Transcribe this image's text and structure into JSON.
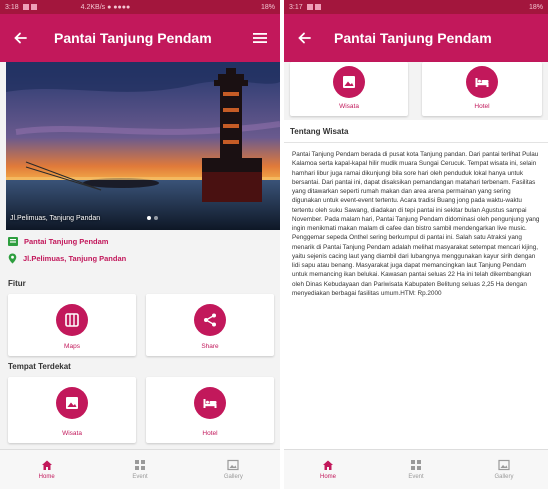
{
  "colors": {
    "primary": "#c2185b",
    "status_bar": "#a3163d",
    "background": "#f3f3f3",
    "inactive": "#9a9a9a"
  },
  "screen_left": {
    "status_bar": {
      "left_text": "3:18",
      "center_text": "4.2KB/s ● ●●●●",
      "right_text": "18%"
    },
    "app_bar": {
      "title": "Pantai Tanjung Pendam",
      "back_icon": "arrow-left-icon",
      "menu_icon": "hamburger-menu-icon"
    },
    "hero": {
      "caption": "Jl.Pelimuas, Tanjung Pandan",
      "slides": 2,
      "active_slide": 1
    },
    "info": {
      "name": "Pantai Tanjung Pendam",
      "address": "Jl.Pelimuas, Tanjung Pandan",
      "name_icon": "place-card-icon",
      "address_icon": "map-pin-icon"
    },
    "fitur": {
      "title": "Fitur",
      "items": [
        {
          "label": "Maps",
          "icon": "map-icon"
        },
        {
          "label": "Share",
          "icon": "share-icon"
        }
      ]
    },
    "nearby": {
      "title": "Tempat Terdekat",
      "items": [
        {
          "label": "Wisata",
          "icon": "image-icon"
        },
        {
          "label": "Hotel",
          "icon": "bed-icon"
        }
      ]
    },
    "bottom_nav": [
      {
        "label": "Home",
        "icon": "home-icon",
        "active": true
      },
      {
        "label": "Event",
        "icon": "grid-icon",
        "active": false
      },
      {
        "label": "Gallery",
        "icon": "photo-icon",
        "active": false
      }
    ]
  },
  "screen_right": {
    "status_bar": {
      "left_text": "3:17",
      "right_text": "18%"
    },
    "app_bar": {
      "title": "Pantai Tanjung Pendam",
      "back_icon": "arrow-left-icon"
    },
    "nearby": [
      {
        "label": "Wisata",
        "icon": "image-icon"
      },
      {
        "label": "Hotel",
        "icon": "bed-icon"
      }
    ],
    "about": {
      "title": "Tentang Wisata",
      "text": "Pantai Tanjung Pendam berada di pusat kota Tanjung pandan. Dari pantai terlihat Pulau Kalamoa serta kapal-kapal hilir mudik muara Sungai Cerucuk. Tempat wisata ini, selain hamhari libur juga ramai dikunjungi bila sore hari oleh penduduk lokal hanya untuk bersantai. Dari pantai ini, dapat disaksikan pemandangan matahari terbenam. Fasilitas yang ditawarkan seperti rumah makan dan area arena permainan yang sering digunakan untuk event-event tertentu. Acara tradisi Buang jong pada waktu-waktu tertentu oleh suku Sawang, diadakan di tepi pantai ini sekitar bulan Agustus sampai November. Pada malam hari, Pantai Tanjung Pendam didominasi oleh pengunjung yang ingin menikmati makan malam di cafee dan bistro sambil mendengarkan live music. Penggemar sepeda Onthel sering berkumpul di pantai ini. Salah satu Atraksi yang menarik di Pantai Tanjung Pendam adalah melihat masyarakat setempat mencari kijing, yaitu sejenis cacing laut yang diambil dari lubangnya menggunakan kayur sirih dengan lidi sapu atau benang. Masyarakat juga dapat memancingkan laut Tanjung Pendam untuk memancing ikan belukai. Kawasan pantai seluas 22 Ha ini telah dikembangkan oleh Dinas Kebudayaan dan Pariwisata Kabupaten Belitung seluas 2,25 Ha dengan menyediakan berbagai fasilitas umum.HTM: Rp.2000"
    },
    "bottom_nav": [
      {
        "label": "Home",
        "icon": "home-icon",
        "active": true
      },
      {
        "label": "Event",
        "icon": "grid-icon",
        "active": false
      },
      {
        "label": "Gallery",
        "icon": "photo-icon",
        "active": false
      }
    ]
  }
}
